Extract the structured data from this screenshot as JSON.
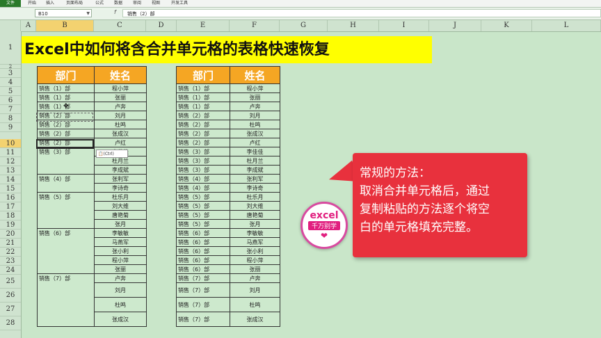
{
  "ribbon": {
    "file": "文件",
    "tabs": [
      "开始",
      "插入",
      "页面布局",
      "公式",
      "数据",
      "审阅",
      "视图",
      "开发工具"
    ]
  },
  "formula_bar": {
    "name_box": "B10",
    "fx": "f",
    "formula": "销售（2）部"
  },
  "columns": [
    "A",
    "B",
    "C",
    "D",
    "E",
    "F",
    "G",
    "H",
    "I",
    "J",
    "K",
    "L"
  ],
  "selected_column": "B",
  "rows": [
    "1",
    "2",
    "3",
    "4",
    "5",
    "6",
    "7",
    "8",
    "9",
    "10",
    "11",
    "12",
    "13",
    "14",
    "15",
    "16",
    "17",
    "18",
    "19",
    "20",
    "21",
    "22",
    "23",
    "24",
    "25",
    "26",
    "27",
    "28"
  ],
  "selected_row": "10",
  "title": "Excel中如何将含合并单元格的表格快速恢复",
  "left_table": {
    "headers": [
      "部门",
      "姓名"
    ],
    "dept_cells": [
      "销售（1）部",
      "销售（1）部",
      "销售（1）部",
      "销售（2）部",
      "销售（2）部",
      "销售（2）部",
      "销售（2）部",
      "销售（3）部",
      "销售（4）部",
      "销售（5）部",
      "销售（6）部",
      "销售（7）部"
    ],
    "names": [
      "程小萍",
      "张丽",
      "卢奔",
      "刘月",
      "杜鸣",
      "张成汉",
      "卢红",
      "李佳佳",
      "杜月兰",
      "李成斌",
      "张利军",
      "李诗奇",
      "杜乐月",
      "刘大维",
      "唐艳菊",
      "张月",
      "李敏敏",
      "马燕军",
      "张小利",
      "程小萍",
      "张丽",
      "卢奔",
      "刘月",
      "杜鸣",
      "张成汉"
    ]
  },
  "right_table": {
    "headers": [
      "部门",
      "姓名"
    ],
    "depts": [
      "销售（1）部",
      "销售（1）部",
      "销售（1）部",
      "销售（2）部",
      "销售（2）部",
      "销售（2）部",
      "销售（2）部",
      "销售（3）部",
      "销售（3）部",
      "销售（3）部",
      "销售（4）部",
      "销售（4）部",
      "销售（5）部",
      "销售（5）部",
      "销售（5）部",
      "销售（5）部",
      "销售（6）部",
      "销售（6）部",
      "销售（6）部",
      "销售（6）部",
      "销售（6）部",
      "销售（7）部",
      "销售（7）部",
      "销售（7）部",
      "销售（7）部"
    ],
    "names": [
      "程小萍",
      "张丽",
      "卢奔",
      "刘月",
      "杜鸣",
      "张成汉",
      "卢红",
      "李佳佳",
      "杜月兰",
      "李成斌",
      "张利军",
      "李诗奇",
      "杜乐月",
      "刘大维",
      "唐艳菊",
      "张月",
      "李敏敏",
      "马燕军",
      "张小利",
      "程小萍",
      "张丽",
      "卢奔",
      "刘月",
      "杜鸣",
      "张成汉"
    ]
  },
  "paste_options": "(Ctrl)",
  "bubble": {
    "lines": [
      "常规的方法：",
      "取消合并单元格后，通过",
      "复制粘贴的方法逐个将空",
      "白的单元格填充完整。"
    ]
  },
  "logo": {
    "line1": "excel",
    "line2": "千万别学"
  },
  "colors": {
    "sheet_bg": "#c9e6c9",
    "header_orange": "#f5a623",
    "title_yellow": "#ffff00",
    "bubble_red": "#e8313d"
  }
}
